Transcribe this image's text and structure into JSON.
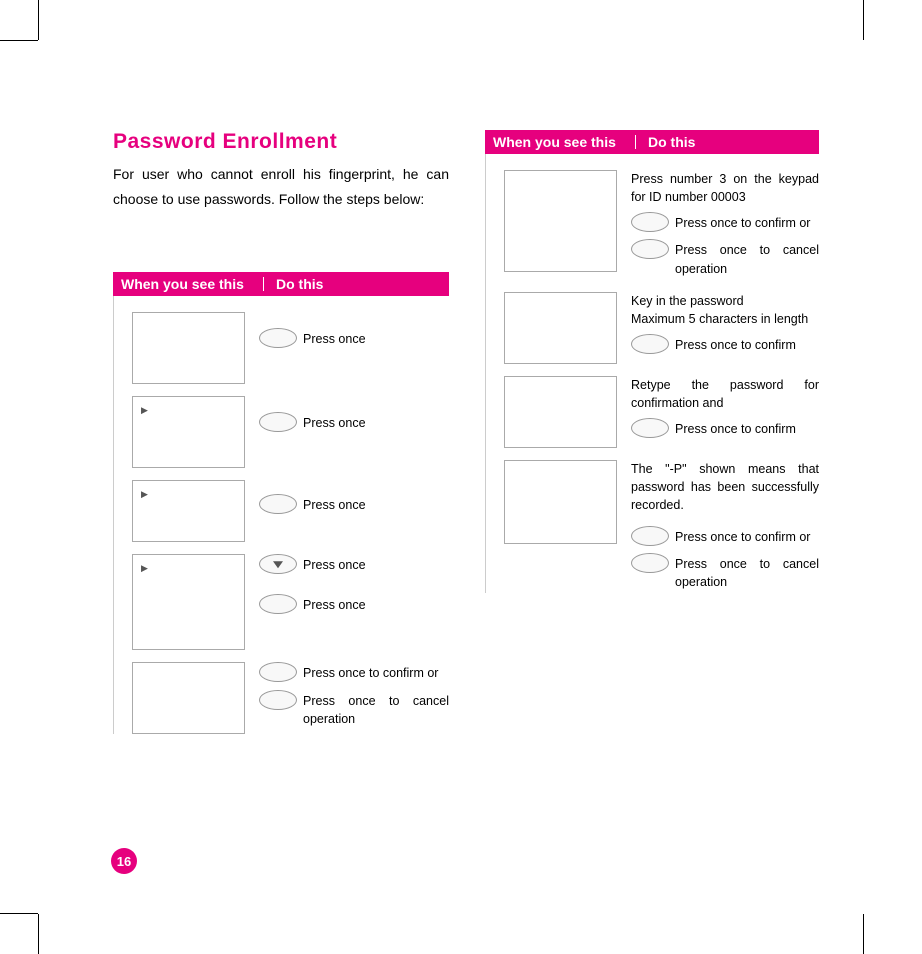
{
  "page_number": "16",
  "title": "Password Enrollment",
  "intro": "For user who cannot enroll his fingerprint, he can choose to use passwords. Follow the steps below:",
  "table_headers": {
    "col1": "When you see this",
    "col2": "Do this"
  },
  "left": {
    "r1": {
      "label": "Press once"
    },
    "r2": {
      "label": "Press once"
    },
    "r3": {
      "label": "Press once"
    },
    "r4": {
      "label1": "Press once",
      "label2": "Press once"
    },
    "r5": {
      "label1": "Press once to confirm or",
      "label2": "Press once to cancel operation"
    }
  },
  "right": {
    "r1": {
      "pre": "Press number 3 on the keypad for ID number 00003",
      "label1": "Press once to confirm or",
      "label2": "Press once to cancel operation"
    },
    "r2": {
      "pre": "Key in the password\nMaximum 5 characters in length",
      "label": "Press once to confirm"
    },
    "r3": {
      "pre": "Retype the password for confirmation and",
      "label": "Press once to confirm"
    },
    "r4": {
      "pre": "The \"-P\" shown means that password has been successfully recorded.",
      "label1": "Press once to confirm or",
      "label2": "Press once to cancel operation"
    }
  }
}
